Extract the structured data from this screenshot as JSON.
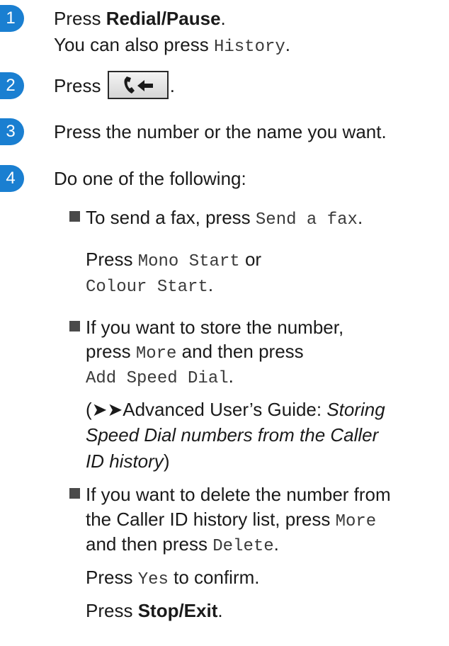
{
  "steps": [
    {
      "number": "1"
    },
    {
      "number": "2"
    },
    {
      "number": "3"
    },
    {
      "number": "4"
    }
  ],
  "step1": {
    "press_word": "Press ",
    "key": "Redial/Pause",
    "period": ".",
    "alt_prefix": "You can also press ",
    "alt_key": "History",
    "alt_period": "."
  },
  "step2": {
    "press_word": "Press ",
    "icon": "phone-arrow-icon",
    "period": "."
  },
  "step3": {
    "text": "Press the number or the name you want."
  },
  "step4": {
    "intro": "Do one of the following:",
    "bullet1": {
      "prefix": "To send a fax, press ",
      "key": "Send a fax",
      "period": ".",
      "line2_prefix": "Press ",
      "key2": "Mono Start",
      "or": " or",
      "key3": "Colour Start",
      "line3_period": "."
    },
    "bullet2": {
      "line1": "If you want to store the number,",
      "prefix2": "press ",
      "key": "More",
      "mid2": " and then press",
      "key2": "Add Speed Dial",
      "period": ".",
      "ref_open": "(",
      "ref_arrows": "➤➤",
      "ref_guide": "Advanced User’s Guide: ",
      "ref_title1": "Storing",
      "ref_title2": "Speed Dial numbers from the Caller",
      "ref_title3": "ID history",
      "ref_close": ")"
    },
    "bullet3": {
      "line1": "If you want to delete the number from",
      "line2": "the Caller ID history list, press ",
      "key": "More",
      "line3_prefix": "and then press ",
      "key2": "Delete",
      "period": ".",
      "confirm_prefix": "Press ",
      "confirm_key": "Yes",
      "confirm_suffix": " to confirm."
    },
    "final": {
      "prefix": "Press ",
      "key": "Stop/Exit",
      "period": "."
    }
  }
}
